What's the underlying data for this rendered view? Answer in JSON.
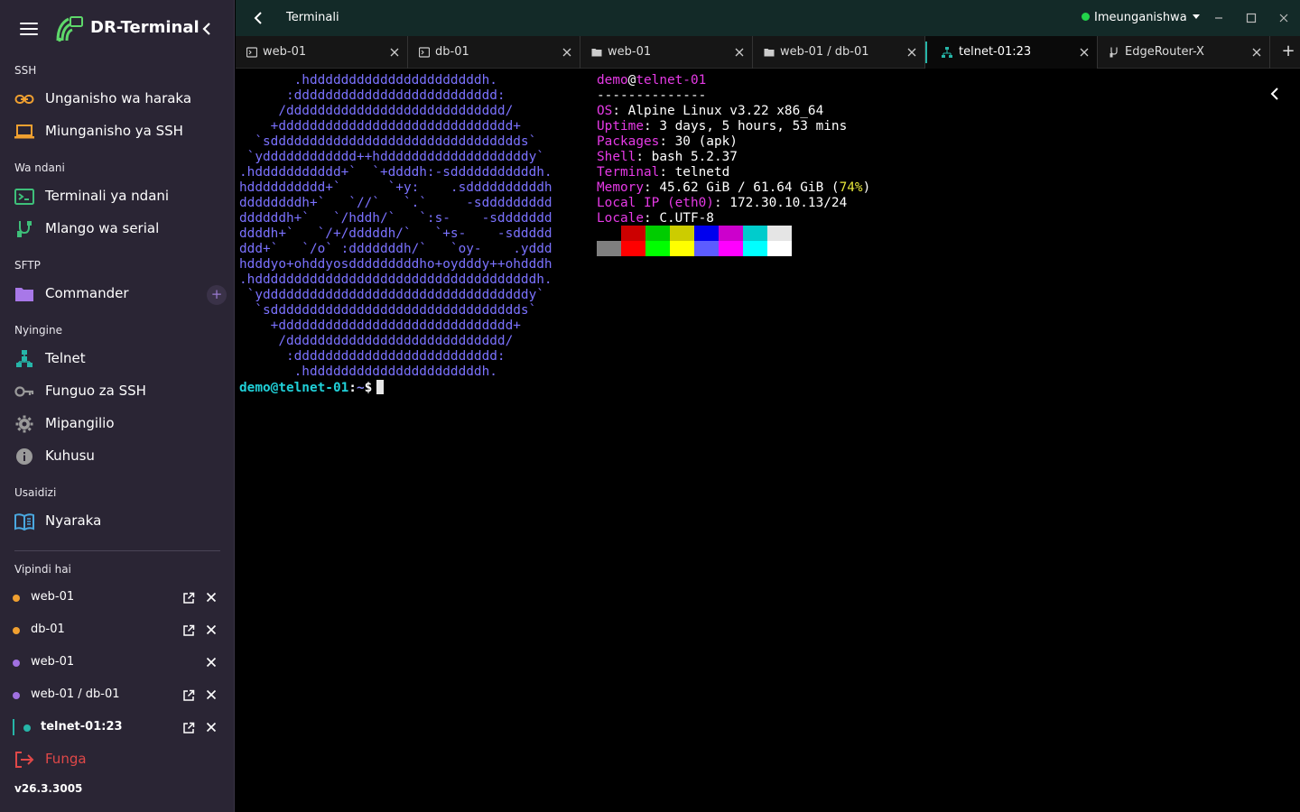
{
  "app": {
    "name": "DR-Terminal",
    "version": "v26.3.3005"
  },
  "sidebar": {
    "sections": {
      "ssh": "SSH",
      "local": "Wa ndani",
      "sftp": "SFTP",
      "other": "Nyingine",
      "help": "Usaidizi",
      "sessions": "Vipindi hai"
    },
    "items": {
      "quick_connect": "Unganisho wa haraka",
      "ssh_connections": "Miunganisho ya SSH",
      "local_terminal": "Terminali ya ndani",
      "serial_port": "Mlango wa serial",
      "commander": "Commander",
      "telnet": "Telnet",
      "ssh_keys": "Funguo za SSH",
      "settings": "Mipangilio",
      "about": "Kuhusu",
      "docs": "Nyaraka"
    },
    "active_sessions": [
      {
        "label": "web-01",
        "dot": "#f0a030"
      },
      {
        "label": "db-01",
        "dot": "#f0a030"
      },
      {
        "label": "web-01",
        "dot": "#a070e0"
      },
      {
        "label": "web-01 / db-01",
        "dot": "#a070e0"
      },
      {
        "label": "telnet-01:23",
        "dot": "#26b5a8"
      }
    ],
    "quit": "Funga"
  },
  "topbar": {
    "title": "Terminali",
    "status": "Imeunganishwa"
  },
  "tabs": [
    {
      "label": "web-01",
      "icon": "terminal-icon"
    },
    {
      "label": "db-01",
      "icon": "terminal-icon"
    },
    {
      "label": "web-01",
      "icon": "folder-icon"
    },
    {
      "label": "web-01 / db-01",
      "icon": "folder-icon"
    },
    {
      "label": "telnet-01:23",
      "icon": "network-icon",
      "active": true
    },
    {
      "label": "EdgeRouter-X",
      "icon": "serial-icon"
    }
  ],
  "terminal": {
    "art": "       .hddddddddddddddddddddddh.\n      :dddddddddddddddddddddddddd:\n     /dddddddddddddddddddddddddddd/\n    +dddddddddddddddddddddddddddddd+\n  `sdddddddddddddddddddddddddddddddds`\n `ydddddddddddd++hdddddddddddddddddddy`\n.hddddddddddd+`  `+ddddh:-sdddddddddddh.\nhdddddddddd+`      `+y:    .sddddddddddh\nddddddddh+`   `//`   `.`     -sddddddddd\nddddddh+`   `/hddh/`   `:s-    -sddddddd\nddddh+`   `/+/dddddh/`   `+s-    -sddddd\nddd+`   `/o` :dddddddh/`   `oy-    .yddd\nhdddyo+ohddyosdddddddddho+oydddy++ohdddh\n.hddddddddddddddddddddddddddddddddddddh.\n `yddddddddddddddddddddddddddddddddddy`\n  `sdddddddddddddddddddddddddddddddds`\n    +dddddddddddddddddddddddddddddd+\n     /dddddddddddddddddddddddddddd/\n      :dddddddddddddddddddddddddd:\n       .hddddddddddddddddddddddh.",
    "prompt_user": "demo@telnet-01",
    "prompt_sep": ":",
    "prompt_path": "~",
    "prompt_symbol": "$",
    "info": {
      "user": "demo",
      "at": "@",
      "host": "telnet-01",
      "sep": "--------------",
      "rows": [
        {
          "key": "OS",
          "value": "Alpine Linux v3.22 x86_64"
        },
        {
          "key": "Uptime",
          "value": "3 days, 5 hours, 53 mins"
        },
        {
          "key": "Packages",
          "value": "30 (apk)"
        },
        {
          "key": "Shell",
          "value": "bash 5.2.37"
        },
        {
          "key": "Terminal",
          "value": "telnetd"
        }
      ],
      "memory_key": "Memory",
      "memory_value": "45.62 GiB / 61.64 GiB (",
      "memory_pct": "74%",
      "memory_close": ")",
      "ip_key": "Local IP",
      "ip_iface": "(eth0)",
      "ip_value": "172.30.10.13/24",
      "locale_key": "Locale",
      "locale_value": "C.UTF-8"
    },
    "palette_row1": [
      "#000000",
      "#cc0000",
      "#00cc00",
      "#cccc00",
      "#0000ee",
      "#cc00cc",
      "#00cccc",
      "#e5e5e5"
    ],
    "palette_row2": [
      "#7f7f7f",
      "#ff0000",
      "#00ff00",
      "#ffff00",
      "#5c5cff",
      "#ff00ff",
      "#00ffff",
      "#ffffff"
    ]
  }
}
